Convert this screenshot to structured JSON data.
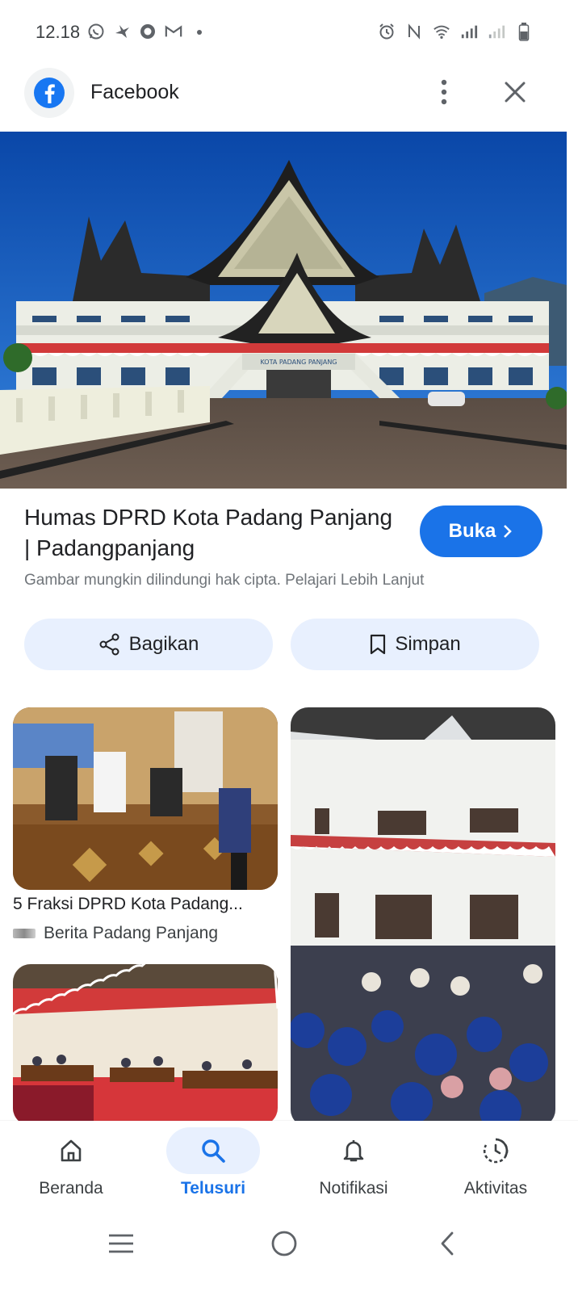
{
  "status_bar": {
    "time": "12.18",
    "left_icons": [
      "whatsapp-icon",
      "bird-icon",
      "record-icon",
      "gmail-icon",
      "dot-icon"
    ],
    "right_icons": [
      "alarm-icon",
      "nfc-icon",
      "wifi-icon",
      "signal-icon",
      "signal-2-icon",
      "battery-icon"
    ]
  },
  "header": {
    "title": "Facebook",
    "app_icon": "facebook-icon",
    "more_icon": "more-vert-icon",
    "close_icon": "close-icon"
  },
  "result": {
    "title": "Humas DPRD Kota Padang Panjang | Padangpanjang",
    "open_button": "Buka",
    "copyright_text": "Gambar mungkin dilindungi hak cipta. Pelajari Lebih Lanjut"
  },
  "actions": {
    "share_label": "Bagikan",
    "save_label": "Simpan"
  },
  "related": [
    {
      "title": "5 Fraksi DPRD Kota Padang...",
      "source": "Berita Padang Panjang"
    }
  ],
  "bottom_nav": {
    "items": [
      {
        "label": "Beranda",
        "icon": "home-icon",
        "active": false
      },
      {
        "label": "Telusuri",
        "icon": "search-icon",
        "active": true
      },
      {
        "label": "Notifikasi",
        "icon": "bell-icon",
        "active": false
      },
      {
        "label": "Aktivitas",
        "icon": "activity-icon",
        "active": false
      }
    ]
  },
  "colors": {
    "accent": "#1a73e8",
    "pill_bg": "#e8f0fe",
    "text_primary": "#202124",
    "text_secondary": "#70757a"
  }
}
